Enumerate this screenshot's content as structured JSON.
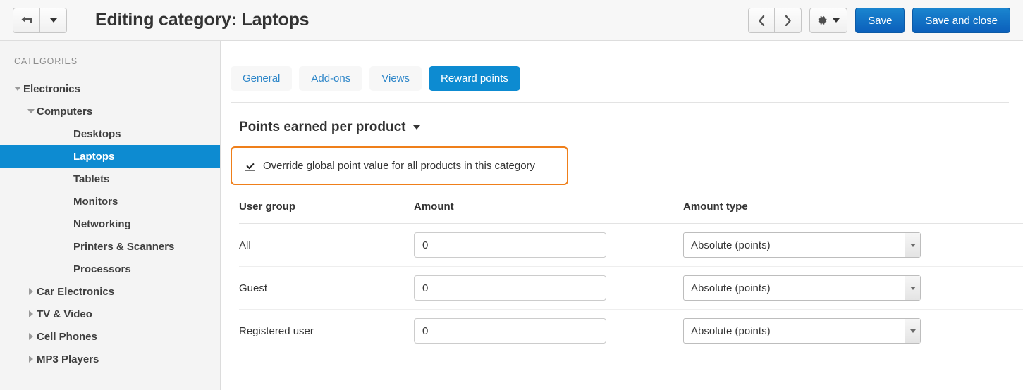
{
  "header": {
    "title": "Editing category: Laptops",
    "back_button": "back-arrow",
    "back_dropdown": "dropdown-caret",
    "prev_button": "‹",
    "next_button": "›",
    "gear_button": "⚙",
    "gear_dropdown": "dropdown-caret",
    "save_label": "Save",
    "save_close_label": "Save and close",
    "accent_blue": "#0d8bd1",
    "bg": "#f7f7f7"
  },
  "sidebar": {
    "title": "CATEGORIES",
    "items": [
      {
        "label": "Electronics",
        "level": 0,
        "state": "expanded",
        "selected": false
      },
      {
        "label": "Computers",
        "level": 1,
        "state": "expanded",
        "selected": false
      },
      {
        "label": "Desktops",
        "level": 2,
        "state": "leaf",
        "selected": false
      },
      {
        "label": "Laptops",
        "level": 2,
        "state": "leaf",
        "selected": true
      },
      {
        "label": "Tablets",
        "level": 2,
        "state": "leaf",
        "selected": false
      },
      {
        "label": "Monitors",
        "level": 2,
        "state": "leaf",
        "selected": false
      },
      {
        "label": "Networking",
        "level": 2,
        "state": "leaf",
        "selected": false
      },
      {
        "label": "Printers & Scanners",
        "level": 2,
        "state": "leaf",
        "selected": false
      },
      {
        "label": "Processors",
        "level": 2,
        "state": "leaf",
        "selected": false
      },
      {
        "label": "Car Electronics",
        "level": 1,
        "state": "collapsed",
        "selected": false
      },
      {
        "label": "TV & Video",
        "level": 1,
        "state": "collapsed",
        "selected": false
      },
      {
        "label": "Cell Phones",
        "level": 1,
        "state": "collapsed",
        "selected": false
      },
      {
        "label": "MP3 Players",
        "level": 1,
        "state": "collapsed",
        "selected": false
      }
    ],
    "selected_bg": "#0d8bd1"
  },
  "main": {
    "tabs": [
      {
        "label": "General",
        "active": false
      },
      {
        "label": "Add-ons",
        "active": false
      },
      {
        "label": "Views",
        "active": false
      },
      {
        "label": "Reward points",
        "active": true
      }
    ],
    "section": {
      "title": "Points earned per product",
      "collapse_icon": "caret-down-icon"
    },
    "override": {
      "checked": true,
      "label": "Override global point value for all products in this category",
      "highlight_color": "#ef7f1a"
    },
    "table": {
      "columns": [
        "User group",
        "Amount",
        "Amount type"
      ],
      "rows": [
        {
          "group": "All",
          "amount": "0",
          "amount_type": "Absolute (points)"
        },
        {
          "group": "Guest",
          "amount": "0",
          "amount_type": "Absolute (points)"
        },
        {
          "group": "Registered user",
          "amount": "0",
          "amount_type": "Absolute (points)"
        }
      ],
      "amount_placeholder": "0"
    }
  }
}
